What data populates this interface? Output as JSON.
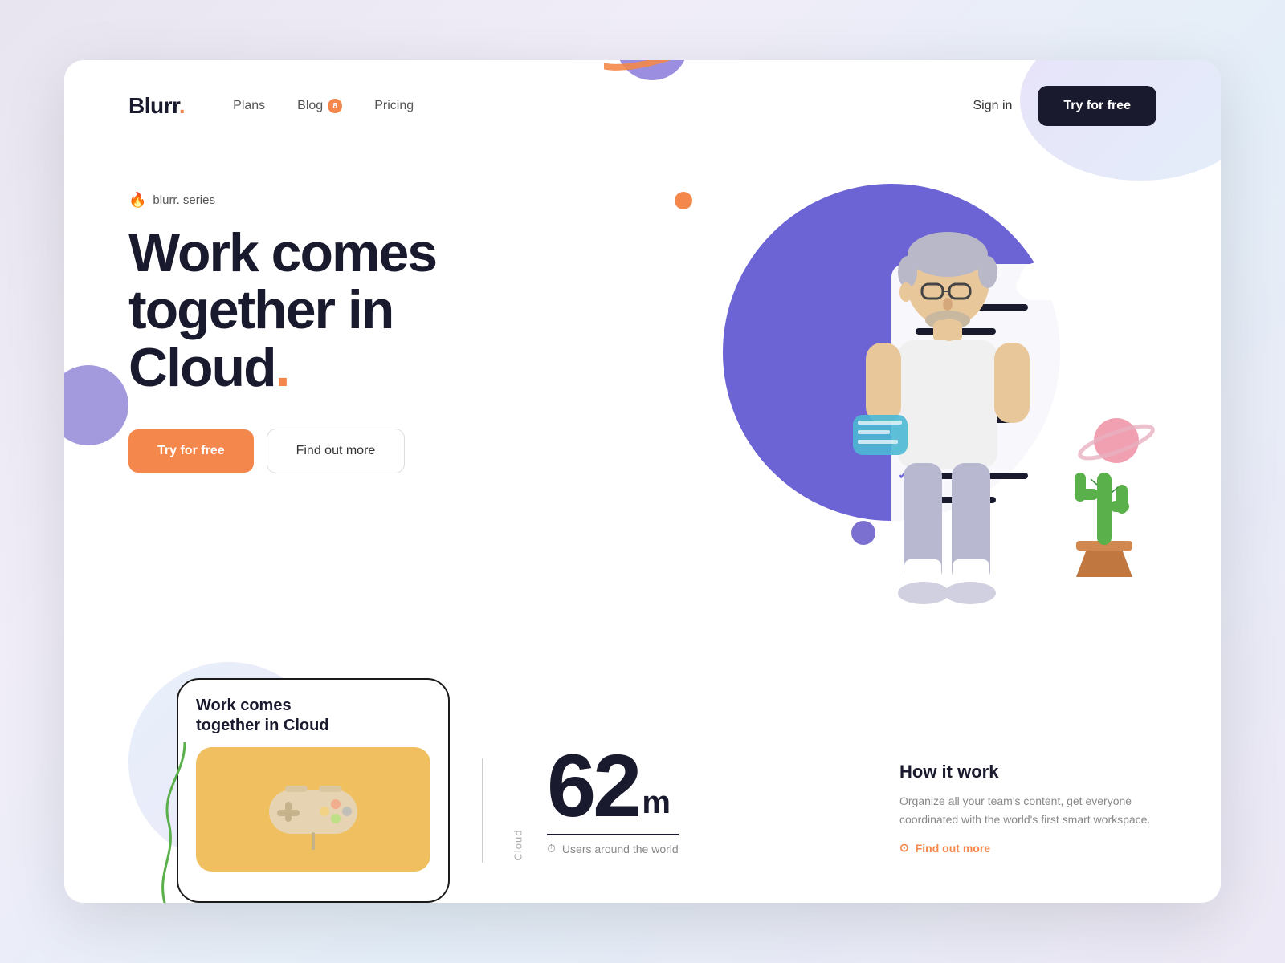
{
  "meta": {
    "title": "Blurr - Work comes together in Cloud"
  },
  "branding": {
    "logo": "Blurr",
    "logo_dot": ".",
    "accent_color": "#f4874b",
    "dark_color": "#1a1a2e",
    "purple_color": "#6c63d4"
  },
  "navbar": {
    "plans_label": "Plans",
    "blog_label": "Blog",
    "blog_badge": "8",
    "pricing_label": "Pricing",
    "signin_label": "Sign in",
    "try_free_label": "Try for free"
  },
  "hero": {
    "series_label": "blurr. series",
    "title_line1": "Work comes",
    "title_line2": "together in",
    "title_line3": "Cloud",
    "title_dot": ".",
    "try_free_btn": "Try for free",
    "find_out_btn": "Find out more"
  },
  "stats": {
    "number": "62",
    "unit": "m",
    "description": "Users around the world",
    "section_label": "Cloud"
  },
  "how_it_works": {
    "title": "How it work",
    "description": "Organize all your team's content, get everyone coordinated with the world's first smart workspace.",
    "link_label": "Find out more"
  },
  "phone_card": {
    "title_line1": "Work comes",
    "title_line2": "together in Cloud"
  },
  "icons": {
    "fire": "🔥",
    "clock": "⏱",
    "circle_arrow": "⊙"
  }
}
